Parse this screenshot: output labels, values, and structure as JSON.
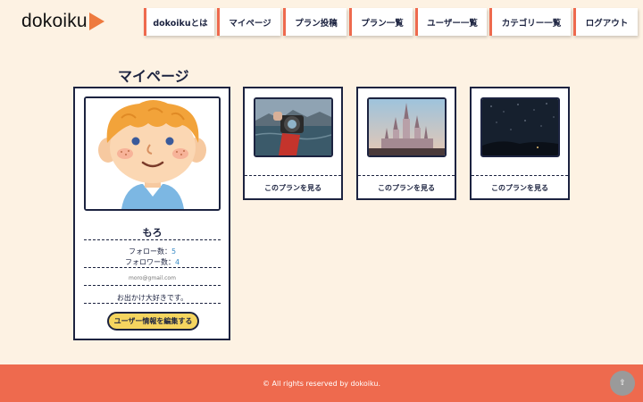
{
  "header": {
    "logo_text": "dokoiku",
    "nav": [
      {
        "label": "dokoikuとは"
      },
      {
        "label": "マイページ"
      },
      {
        "label": "プラン投稿"
      },
      {
        "label": "プラン一覧"
      },
      {
        "label": "ユーザー一覧"
      },
      {
        "label": "カテゴリー一覧"
      },
      {
        "label": "ログアウト"
      }
    ]
  },
  "page": {
    "title": "マイページ"
  },
  "profile": {
    "name": "もろ",
    "follow_label": "フォロー数：",
    "follow_count": "5",
    "follower_label": "フォロワー数：",
    "follower_count": "4",
    "email": "moro@gmail.com",
    "bio": "お出かけ大好きです。",
    "edit_button": "ユーザー情報を編集する"
  },
  "plans": [
    {
      "link_label": "このプランを見る",
      "image": "camera-lake-photo"
    },
    {
      "link_label": "このプランを見る",
      "image": "castle-photo"
    },
    {
      "link_label": "このプランを見る",
      "image": "night-sky-photo"
    }
  ],
  "footer": {
    "copyright": "© All rights reserved by dokoiku."
  },
  "scroll_top": {
    "icon": "up-arrow-icon",
    "glyph": "⇧"
  },
  "colors": {
    "background": "#fdf2e3",
    "accent": "#ee6a4e",
    "navy": "#1c2340",
    "button_yellow": "#f5d55f",
    "link_blue": "#3a8bc5"
  }
}
